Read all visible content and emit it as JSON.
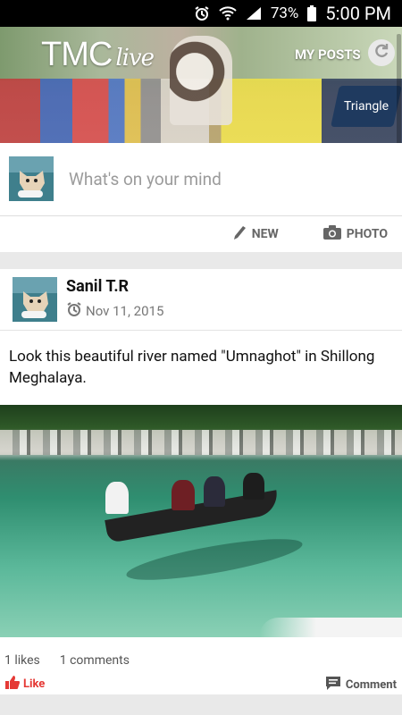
{
  "status_bar": {
    "battery": "73%",
    "time": "5:00 PM"
  },
  "header": {
    "logo_main": "TMC",
    "logo_sub": "live",
    "my_posts_label": "MY POSTS",
    "banner_tag": "Triangle"
  },
  "composer": {
    "placeholder": "What's on your mind",
    "new_label": "NEW",
    "photo_label": "PHOTO"
  },
  "post": {
    "author": "Sanil T.R",
    "date": "Nov 11, 2015",
    "text": "Look this beautiful river named \"Umnaghot\" in Shillong Meghalaya.",
    "likes": "1 likes",
    "comments": "1 comments",
    "like_label": "Like",
    "comment_label": "Comment"
  },
  "colors": {
    "like_red": "#e53935",
    "text_gray": "#777777"
  },
  "icons": [
    "alarm-icon",
    "wifi-icon",
    "signal-icon",
    "battery-icon",
    "refresh-icon",
    "pencil-icon",
    "camera-icon",
    "clock-icon",
    "thumbs-up-icon",
    "comment-icon"
  ]
}
